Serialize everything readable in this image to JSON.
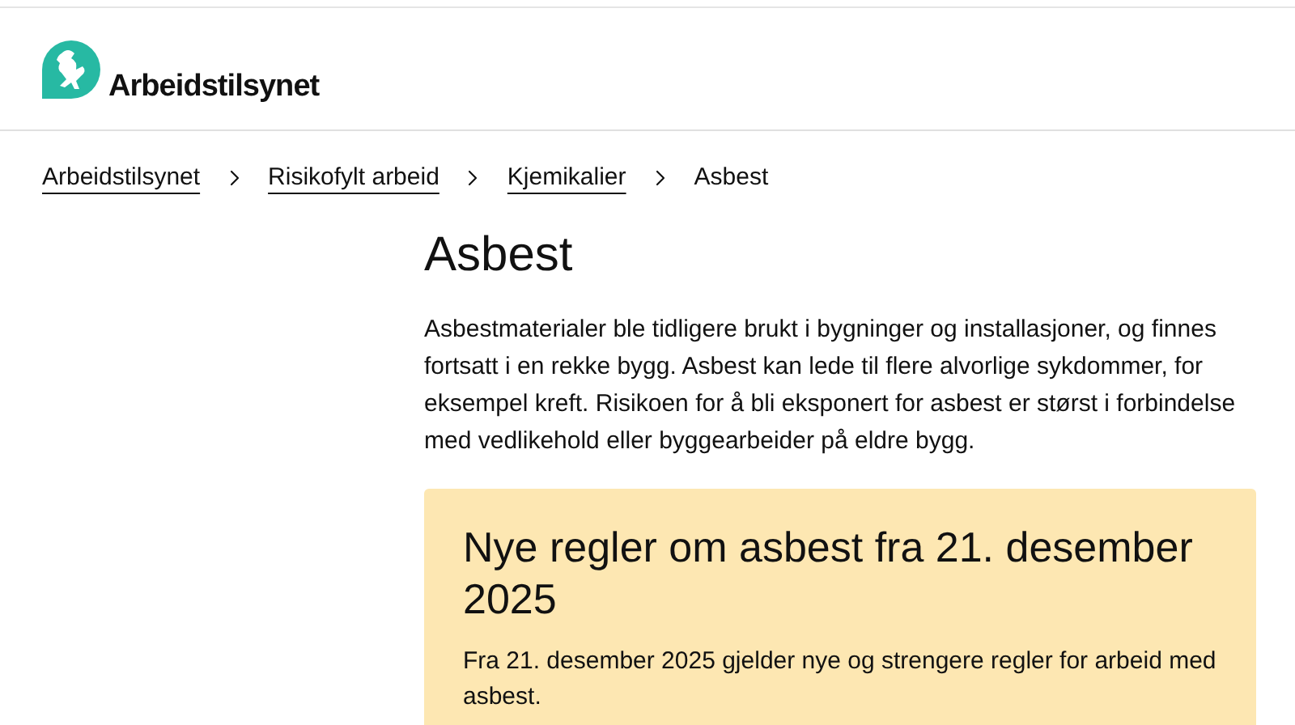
{
  "header": {
    "logo_text": "Arbeidstilsynet"
  },
  "breadcrumbs": [
    {
      "label": "Arbeidstilsynet",
      "kind": "link"
    },
    {
      "label": "Risikofylt arbeid",
      "kind": "link"
    },
    {
      "label": "Kjemikalier",
      "kind": "link"
    },
    {
      "label": "Asbest",
      "kind": "current"
    }
  ],
  "page": {
    "title": "Asbest",
    "intro": "Asbestmaterialer ble tidligere brukt i bygninger og installasjoner, og finnes fortsatt i en rekke bygg. Asbest kan lede til flere alvorlige sykdommer, for eksempel kreft. Risikoen for å bli eksponert for asbest er størst i forbindelse med vedlikehold eller byggearbeider på eldre bygg."
  },
  "notice": {
    "title": "Nye regler om asbest fra 21. desember 2025",
    "text": "Fra 21. desember 2025 gjelder nye og strengere regler for arbeid med asbest."
  }
}
